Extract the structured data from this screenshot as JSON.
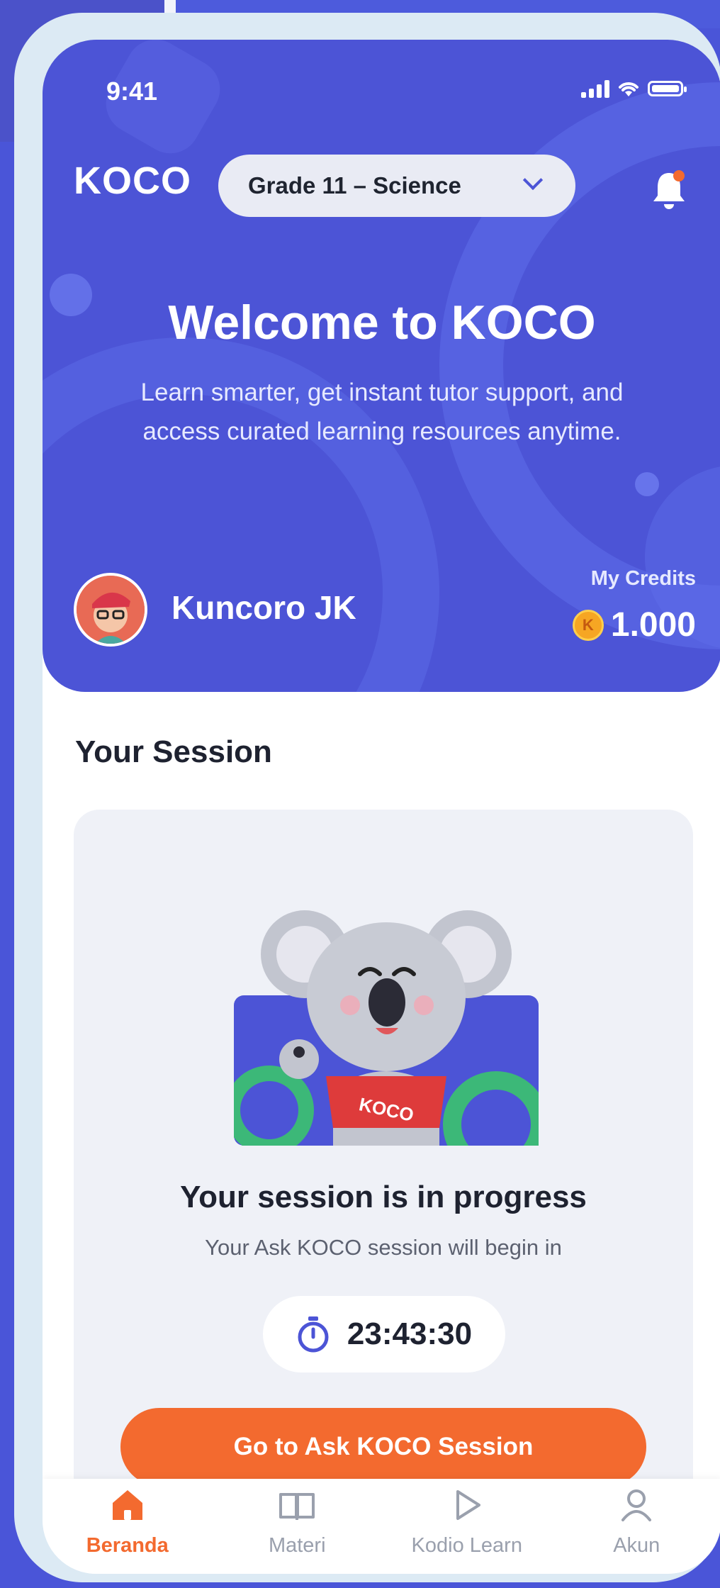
{
  "status_bar": {
    "time": "9:41"
  },
  "header": {
    "logo": "KOCO",
    "grade_selector": {
      "selected": "Grade 11 – Science"
    }
  },
  "hero": {
    "title": "Welcome to KOCO",
    "subtitle": "Learn smarter, get instant tutor support, and access curated learning resources anytime."
  },
  "user": {
    "name": "Kuncoro JK",
    "credits_label": "My Credits",
    "credits_value": "1.000",
    "coin_symbol": "K"
  },
  "session": {
    "section_title": "Your Session",
    "heading": "Your session is in progress",
    "subtext": "Your Ask KOCO session will begin in",
    "countdown": "23:43:30",
    "cta_label": "Go to Ask KOCO Session",
    "mascot_shirt_text": "KOCO"
  },
  "bottom_nav": {
    "items": [
      {
        "label": "Beranda",
        "icon": "home-icon",
        "active": true
      },
      {
        "label": "Materi",
        "icon": "book-icon",
        "active": false
      },
      {
        "label": "Kodio Learn",
        "icon": "play-icon",
        "active": false
      },
      {
        "label": "Akun",
        "icon": "user-icon",
        "active": false
      }
    ]
  },
  "colors": {
    "primary": "#4c54d6",
    "accent": "#f36a2f",
    "card_bg": "#eff1f7",
    "coin": "#f6a623"
  }
}
